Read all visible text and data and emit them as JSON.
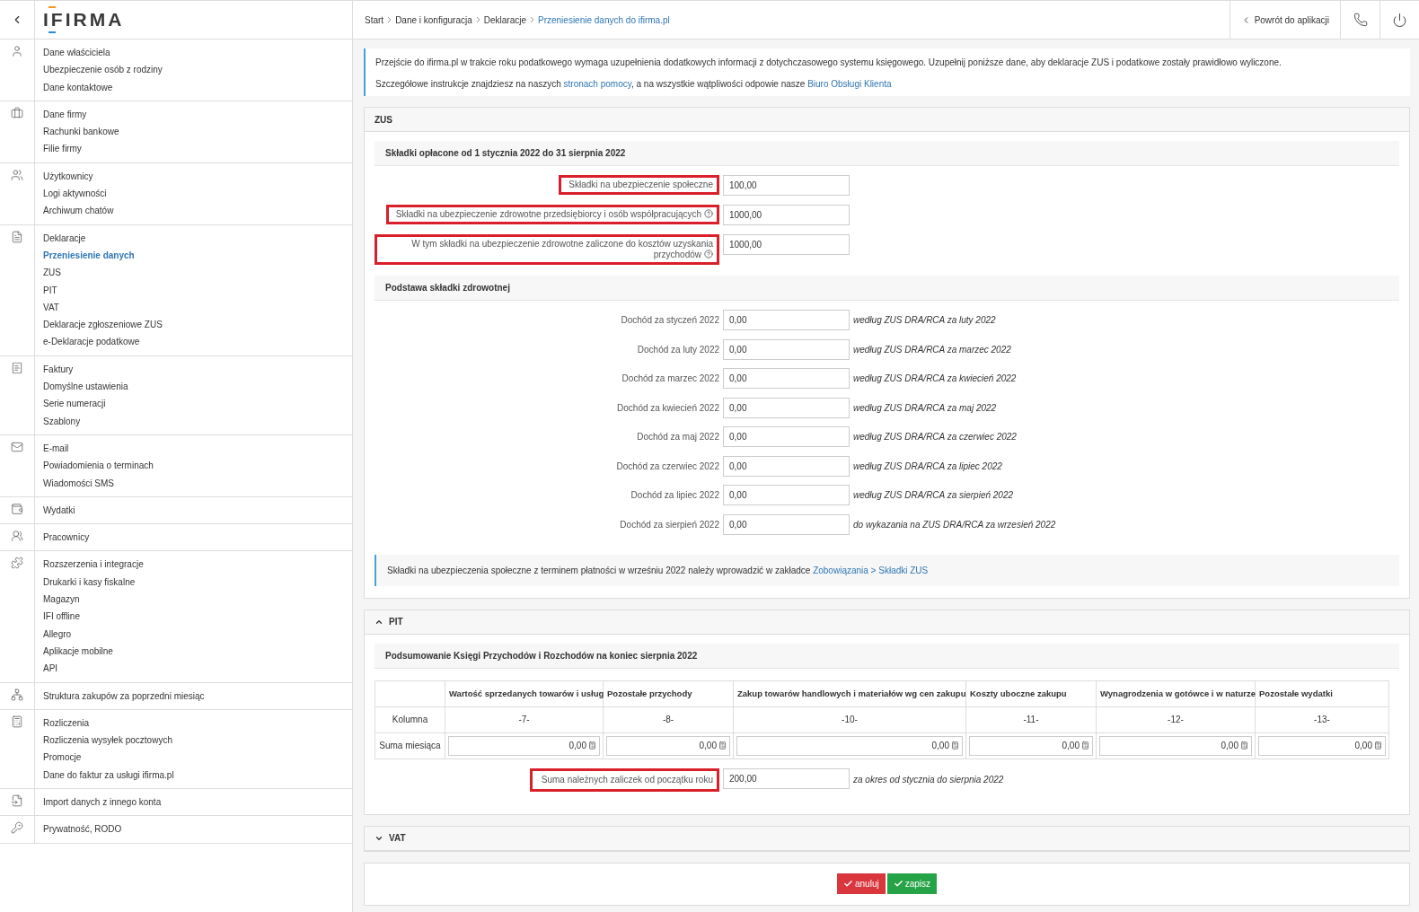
{
  "sidebar": {
    "logo": "IFIRMA",
    "groups": [
      {
        "items": [
          {
            "label": "Dane właściciela",
            "selected": false
          },
          {
            "label": "Ubezpieczenie osób z rodziny",
            "selected": false
          },
          {
            "label": "Dane kontaktowe",
            "selected": false
          }
        ]
      },
      {
        "items": [
          {
            "label": "Dane firmy",
            "selected": false
          },
          {
            "label": "Rachunki bankowe",
            "selected": false
          },
          {
            "label": "Filie firmy",
            "selected": false
          }
        ]
      },
      {
        "items": [
          {
            "label": "Użytkownicy",
            "selected": false
          },
          {
            "label": "Logi aktywności",
            "selected": false
          },
          {
            "label": "Archiwum chatów",
            "selected": false
          }
        ]
      },
      {
        "items": [
          {
            "label": "Deklaracje",
            "selected": false
          },
          {
            "label": "Przeniesienie danych",
            "selected": true
          },
          {
            "label": "ZUS",
            "selected": false
          },
          {
            "label": "PIT",
            "selected": false
          },
          {
            "label": "VAT",
            "selected": false
          },
          {
            "label": "Deklaracje zgłoszeniowe ZUS",
            "selected": false
          },
          {
            "label": "e-Deklaracje podatkowe",
            "selected": false
          }
        ]
      },
      {
        "items": [
          {
            "label": "Faktury",
            "selected": false
          },
          {
            "label": "Domyślne ustawienia",
            "selected": false
          },
          {
            "label": "Serie numeracji",
            "selected": false
          },
          {
            "label": "Szablony",
            "selected": false
          }
        ]
      },
      {
        "items": [
          {
            "label": "E-mail",
            "selected": false
          },
          {
            "label": "Powiadomienia o terminach",
            "selected": false
          },
          {
            "label": "Wiadomości SMS",
            "selected": false
          }
        ]
      },
      {
        "items": [
          {
            "label": "Wydatki",
            "selected": false
          }
        ]
      },
      {
        "items": [
          {
            "label": "Pracownicy",
            "selected": false
          }
        ]
      },
      {
        "items": [
          {
            "label": "Rozszerzenia i integracje",
            "selected": false
          },
          {
            "label": "Drukarki i kasy fiskalne",
            "selected": false
          },
          {
            "label": "Magazyn",
            "selected": false
          },
          {
            "label": "IFI offline",
            "selected": false
          },
          {
            "label": "Allegro",
            "selected": false
          },
          {
            "label": "Aplikacje mobilne",
            "selected": false
          },
          {
            "label": "API",
            "selected": false
          }
        ]
      },
      {
        "items": [
          {
            "label": "Struktura zakupów za poprzedni miesiąc",
            "selected": false
          }
        ]
      },
      {
        "items": [
          {
            "label": "Rozliczenia",
            "selected": false
          },
          {
            "label": "Rozliczenia wysyłek pocztowych",
            "selected": false
          },
          {
            "label": "Promocje",
            "selected": false
          },
          {
            "label": "Dane do faktur za usługi ifirma.pl",
            "selected": false
          }
        ]
      },
      {
        "items": [
          {
            "label": "Import danych z innego konta",
            "selected": false
          }
        ]
      },
      {
        "items": [
          {
            "label": "Prywatność, RODO",
            "selected": false
          }
        ]
      }
    ]
  },
  "breadcrumb": [
    {
      "label": "Start",
      "selected": false
    },
    {
      "label": "Dane i konfiguracja",
      "selected": false
    },
    {
      "label": "Deklaracje",
      "selected": false
    },
    {
      "label": "Przeniesienie danych do ifirma.pl",
      "selected": true
    }
  ],
  "header": {
    "back_link": "Powrót do aplikacji"
  },
  "info": {
    "lines": [
      [
        {
          "text": "Przejście do ifirma.pl w trakcie roku podatkowego wymaga uzupełnienia dodatkowych informacji z dotychczasowego systemu księgowego. Uzupełnij poniższe dane, aby deklaracje ZUS i podatkowe zostały prawidłowo wyliczone.",
          "link": false
        }
      ],
      [
        {
          "text": "Szczegółowe instrukcje znajdziesz na naszych ",
          "link": false
        },
        {
          "text": "stronach pomocy",
          "link": true
        },
        {
          "text": ", a na wszystkie wątpliwości odpowie nasze ",
          "link": false
        },
        {
          "text": "Biuro Obsługi Klienta",
          "link": true
        }
      ]
    ]
  },
  "zus": {
    "title": "ZUS",
    "paid": {
      "title": "Składki opłacone od 1 stycznia 2022 do 31 sierpnia 2022",
      "fields": [
        {
          "label": "Składki na ubezpieczenie społeczne",
          "value": "100,00",
          "help": false,
          "highlighted": true
        },
        {
          "label": "Składki na ubezpieczenie zdrowotne przedsiębiorcy i osób współpracujących",
          "value": "1000,00",
          "help": true,
          "highlighted": true
        },
        {
          "label": "W tym składki na ubezpieczenie zdrowotne zaliczone do kosztów uzyskania przychodów",
          "value": "1000,00",
          "help": true,
          "highlighted": true
        }
      ]
    },
    "base": {
      "title": "Podstawa składki zdrowotnej",
      "rows": [
        {
          "label": "Dochód za styczeń 2022",
          "value": "0,00",
          "note": "według ZUS DRA/RCA za luty 2022"
        },
        {
          "label": "Dochód za luty 2022",
          "value": "0,00",
          "note": "według ZUS DRA/RCA za marzec 2022"
        },
        {
          "label": "Dochód za marzec 2022",
          "value": "0,00",
          "note": "według ZUS DRA/RCA za kwiecień 2022"
        },
        {
          "label": "Dochód za kwiecień 2022",
          "value": "0,00",
          "note": "według ZUS DRA/RCA za maj 2022"
        },
        {
          "label": "Dochód za maj 2022",
          "value": "0,00",
          "note": "według ZUS DRA/RCA za czerwiec 2022"
        },
        {
          "label": "Dochód za czerwiec 2022",
          "value": "0,00",
          "note": "według ZUS DRA/RCA za lipiec 2022"
        },
        {
          "label": "Dochód za lipiec 2022",
          "value": "0,00",
          "note": "według ZUS DRA/RCA za sierpień 2022"
        },
        {
          "label": "Dochód za sierpień 2022",
          "value": "0,00",
          "note": "do wykazania na ZUS DRA/RCA za wrzesień 2022"
        }
      ]
    },
    "notice": [
      {
        "text": "Składki na ubezpieczenia społeczne z terminem płatności w wrześniu 2022 należy wprowadzić w zakładce ",
        "link": false
      },
      {
        "text": "Zobowiązania > Składki ZUS",
        "link": true
      }
    ]
  },
  "pit": {
    "title": "PIT",
    "expanded": true,
    "subtitle": "Podsumowanie Księgi Przychodów i Rozchodów na koniec sierpnia 2022",
    "columns": [
      "Wartość sprzedanych towarów i usług",
      "Pozostałe przychody",
      "Zakup towarów handlowych i materiałów wg cen zakupu",
      "Koszty uboczne zakupu",
      "Wynagrodzenia w gotówce i w naturze",
      "Pozostałe wydatki"
    ],
    "rows": [
      {
        "label": "Kolumna",
        "kind": "text",
        "cells": [
          "-7-",
          "-8-",
          "-10-",
          "-11-",
          "-12-",
          "-13-"
        ]
      },
      {
        "label": "Suma miesiąca",
        "kind": "input",
        "cells": [
          "0,00",
          "0,00",
          "0,00",
          "0,00",
          "0,00",
          "0,00"
        ]
      }
    ],
    "total": {
      "label": "Suma należnych zaliczek od początku roku",
      "value": "200,00",
      "note": "za okres od stycznia do sierpnia 2022",
      "highlighted": true
    }
  },
  "vat": {
    "title": "VAT",
    "expanded": false
  },
  "buttons": [
    {
      "label": "anuluj",
      "kind": "cancel"
    },
    {
      "label": "zapisz",
      "kind": "save"
    }
  ]
}
